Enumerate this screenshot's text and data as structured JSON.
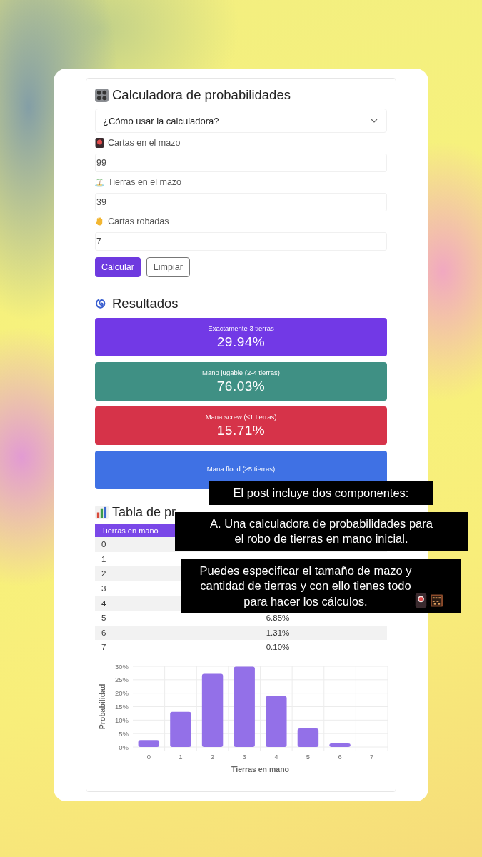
{
  "calculator": {
    "title": "Calculadora de probabilidades",
    "accordion": {
      "label": "¿Cómo usar la calculadora?",
      "expanded": false
    },
    "fields": [
      {
        "label": "Cartas en el mazo",
        "value": "99"
      },
      {
        "label": "Tierras en el mazo",
        "value": "39"
      },
      {
        "label": "Cartas robadas",
        "value": "7"
      }
    ],
    "buttons": [
      {
        "label": "Calcular",
        "kind": "primary"
      },
      {
        "label": "Limpiar",
        "kind": "outline"
      }
    ]
  },
  "results": {
    "title": "Resultados",
    "items": [
      {
        "label": "Exactamente 3 tierras",
        "value": "29.94%",
        "color": "#7239e6"
      },
      {
        "label": "Mano jugable (2-4 tierras)",
        "value": "76.03%",
        "color": "#3f9084"
      },
      {
        "label": "Mana screw (≤1 tierras)",
        "value": "15.71%",
        "color": "#d63349"
      },
      {
        "label": "Mana flood (≥5 tierras)",
        "color": "#3f71e4"
      }
    ]
  },
  "table": {
    "title": "Tabla de pr",
    "columns": [
      "Tierras en mano"
    ],
    "rows": [
      {
        "lands": "0"
      },
      {
        "lands": "1"
      },
      {
        "lands": "2"
      },
      {
        "lands": "3"
      },
      {
        "lands": "4"
      },
      {
        "lands": "5",
        "probability": "6.85%"
      },
      {
        "lands": "6",
        "probability": "1.31%"
      },
      {
        "lands": "7",
        "probability": "0.10%"
      }
    ]
  },
  "chart": {
    "chart_data": {
      "type": "bar",
      "xlabel": "Tierras en mano",
      "ylabel": "Probabilidad",
      "categories": [
        "0",
        "1",
        "2",
        "3",
        "4",
        "5",
        "6",
        "7"
      ],
      "series": [
        {
          "color": "#9370e8",
          "values": [
            2.6,
            13.1,
            27.2,
            29.9,
            18.9,
            6.9,
            1.3,
            null
          ]
        }
      ],
      "ylim": [
        0,
        30
      ],
      "grid": true,
      "yticks": [
        {
          "value": 0,
          "label": "0%"
        },
        {
          "value": 5,
          "label": "5%"
        },
        {
          "value": 10,
          "label": "10%"
        },
        {
          "value": 15,
          "label": "15%"
        },
        {
          "value": 20,
          "label": "20%"
        },
        {
          "value": 25,
          "label": "25%"
        },
        {
          "value": 30,
          "label": "30%"
        }
      ]
    }
  },
  "captions": [
    "El post incluye dos componentes:",
    "A. Una calculadora de probabilidades para\nel robo de tierras en mano inicial.",
    "Puedes especificar el tamaño de mazo y\ncantidad de tierras y con ello tienes todo\npara hacer los cálculos."
  ]
}
